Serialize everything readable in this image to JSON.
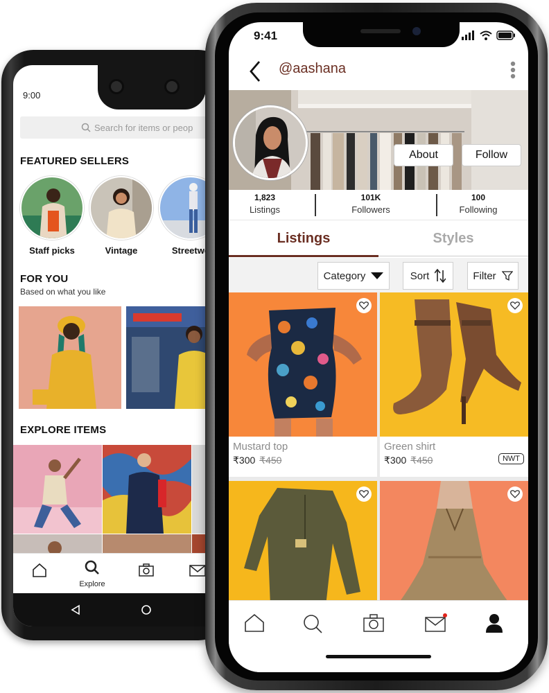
{
  "back_app": {
    "status_time": "9:00",
    "search_placeholder": "Search for items or peop",
    "featured_title": "FEATURED SELLERS",
    "sellers": [
      {
        "label": "Staff picks"
      },
      {
        "label": "Vintage"
      },
      {
        "label": "Streetwe"
      }
    ],
    "for_you_title": "FOR YOU",
    "for_you_subtitle": "Based on what you like",
    "explore_title": "EXPLORE ITEMS",
    "nav": {
      "explore_label": "Explore"
    }
  },
  "front_app": {
    "status_time": "9:41",
    "handle": "@aashana",
    "about_label": "About",
    "follow_label": "Follow",
    "stats": [
      {
        "value": "1,823",
        "label": "Listings"
      },
      {
        "value": "101K",
        "label": "Followers"
      },
      {
        "value": "100",
        "label": "Following"
      }
    ],
    "tabs": [
      {
        "label": "Listings",
        "active": true
      },
      {
        "label": "Styles",
        "active": false
      }
    ],
    "filters": {
      "category_label": "Category",
      "sort_label": "Sort",
      "filter_label": "Filter"
    },
    "listings": [
      {
        "title": "Mustard top",
        "price": "₹300",
        "original_price": "₹450",
        "badge": "",
        "bg": "#f7873a"
      },
      {
        "title": "Green shirt",
        "price": "₹300",
        "original_price": "₹450",
        "badge": "NWT",
        "bg": "#f6bb24"
      },
      {
        "title": "",
        "price": "",
        "original_price": "",
        "badge": "",
        "bg": "#f6b71c"
      },
      {
        "title": "",
        "price": "",
        "original_price": "",
        "badge": "",
        "bg": "#f3875f"
      }
    ]
  },
  "colors": {
    "accent": "#6a2e22",
    "muted": "#a9a9a9",
    "notification_dot": "#e0241c"
  }
}
